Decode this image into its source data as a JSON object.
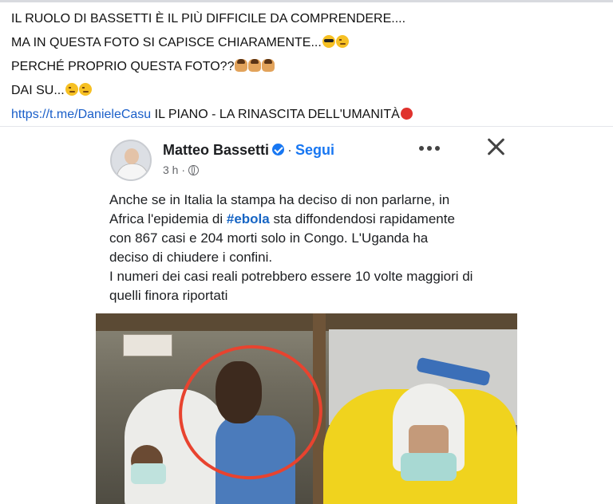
{
  "post": {
    "lines": [
      "IL RUOLO DI BASSETTI È IL PIÙ DIFFICILE DA COMPRENDERE....",
      "MA IN QUESTA FOTO SI CAPISCE CHIARAMENTE...",
      "PERCHÉ PROPRIO QUESTA FOTO??",
      "DAI SU..."
    ],
    "link_text": "https://t.me/DanieleCasu",
    "link_suffix": " IL PIANO - LA RINASCITA DELL'UMANITÀ",
    "emoji": {
      "line2": [
        "smiling-face-with-sunglasses",
        "winking-face"
      ],
      "line3": [
        "person-shrugging",
        "person-shrugging",
        "person-shrugging"
      ],
      "line4": [
        "winking-face",
        "winking-face"
      ],
      "line5": [
        "red-circle"
      ]
    }
  },
  "shared_card": {
    "author": "Matteo Bassetti",
    "separator": "·",
    "follow_label": "Segui",
    "time": "3 h",
    "time_sep": "·",
    "text_lines": {
      "l1": "Anche se in Italia la stampa ha deciso di non parlarne, in",
      "l2_pre": "Africa l'epidemia di ",
      "l2_hashtag": "#ebola",
      "l2_post": " sta diffondendosi rapidamente",
      "l3": "con 867 casi  e 204 morti solo in Congo. L'Uganda ha",
      "l4": "deciso di chiudere i confini.",
      "l5": "I numeri dei casi reali potrebbero essere 10 volte maggiori di",
      "l6": "quelli finora riportati"
    },
    "icons": {
      "verified": "verified-badge-icon",
      "privacy": "globe-icon",
      "more": "more-options-icon",
      "close": "close-icon"
    },
    "colors": {
      "link": "#1a5fc9",
      "follow": "#1877f2",
      "hashtag": "#1765c4",
      "annotation_circle": "#e8432f"
    }
  }
}
